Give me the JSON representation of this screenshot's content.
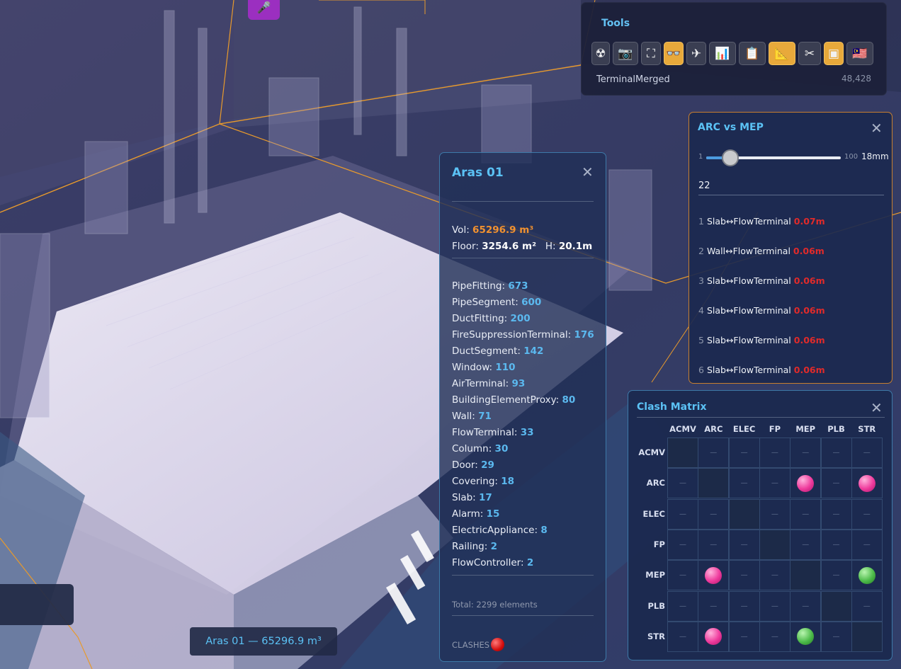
{
  "tools": {
    "title": "Tools",
    "buttons": [
      {
        "name": "radiation-icon",
        "glyph": "☢"
      },
      {
        "name": "camera-icon",
        "glyph": "📷"
      },
      {
        "name": "fullscreen-icon",
        "glyph": "⛶"
      },
      {
        "name": "glasses-icon",
        "glyph": "👓",
        "active": true
      },
      {
        "name": "airplane-icon",
        "glyph": "✈"
      },
      {
        "name": "bar-chart-icon",
        "glyph": "📊"
      },
      {
        "name": "clipboard-icon",
        "glyph": "📋"
      },
      {
        "name": "triangle-ruler-icon",
        "glyph": "📐",
        "active": true
      },
      {
        "name": "scissors-icon",
        "glyph": "✂"
      },
      {
        "name": "floor-plan-icon",
        "glyph": "▣",
        "active": true
      },
      {
        "name": "malaysia-flag-icon",
        "glyph": "🇲🇾"
      }
    ],
    "model_name": "TerminalMerged",
    "model_count": "48,428"
  },
  "clash_detection": {
    "title": "ARC vs MEP",
    "slider_min": "1",
    "slider_max": "100",
    "slider_value_label": "18mm",
    "slider_position": 0.18,
    "clash_count": "22",
    "items": [
      {
        "index": "1",
        "label": "Slab↔FlowTerminal",
        "distance": "0.07m"
      },
      {
        "index": "2",
        "label": "Wall↔FlowTerminal",
        "distance": "0.06m"
      },
      {
        "index": "3",
        "label": "Slab↔FlowTerminal",
        "distance": "0.06m"
      },
      {
        "index": "4",
        "label": "Slab↔FlowTerminal",
        "distance": "0.06m"
      },
      {
        "index": "5",
        "label": "Slab↔FlowTerminal",
        "distance": "0.06m"
      },
      {
        "index": "6",
        "label": "Slab↔FlowTerminal",
        "distance": "0.06m"
      }
    ]
  },
  "aras": {
    "title": "Aras 01",
    "vol_label": "Vol:",
    "vol_value": "65296.9 m³",
    "floor_label": "Floor:",
    "floor_value": "3254.6 m²",
    "height_label": "H:",
    "height_value": "20.1m",
    "elements": [
      {
        "type": "PipeFitting",
        "count": "673"
      },
      {
        "type": "PipeSegment",
        "count": "600"
      },
      {
        "type": "DuctFitting",
        "count": "200"
      },
      {
        "type": "FireSuppressionTerminal",
        "count": "176"
      },
      {
        "type": "DuctSegment",
        "count": "142"
      },
      {
        "type": "Window",
        "count": "110"
      },
      {
        "type": "AirTerminal",
        "count": "93"
      },
      {
        "type": "BuildingElementProxy",
        "count": "80"
      },
      {
        "type": "Wall",
        "count": "71"
      },
      {
        "type": "FlowTerminal",
        "count": "33"
      },
      {
        "type": "Column",
        "count": "30"
      },
      {
        "type": "Door",
        "count": "29"
      },
      {
        "type": "Covering",
        "count": "18"
      },
      {
        "type": "Slab",
        "count": "17"
      },
      {
        "type": "Alarm",
        "count": "15"
      },
      {
        "type": "ElectricAppliance",
        "count": "8"
      },
      {
        "type": "Railing",
        "count": "2"
      },
      {
        "type": "FlowController",
        "count": "2"
      }
    ],
    "total": "Total: 2299 elements",
    "clashes_label": "CLASHES"
  },
  "matrix": {
    "title": "Clash Matrix",
    "columns": [
      "ACMV",
      "ARC",
      "ELEC",
      "FP",
      "MEP",
      "PLB",
      "STR"
    ],
    "rows": [
      "ACMV",
      "ARC",
      "ELEC",
      "FP",
      "MEP",
      "PLB",
      "STR"
    ],
    "empty_symbol": "—",
    "cells": [
      [
        "diag",
        "empty",
        "empty",
        "empty",
        "empty",
        "empty",
        "empty"
      ],
      [
        "empty",
        "diag",
        "empty",
        "empty",
        "pink",
        "empty",
        "pink"
      ],
      [
        "empty",
        "empty",
        "diag",
        "empty",
        "empty",
        "empty",
        "empty"
      ],
      [
        "empty",
        "empty",
        "empty",
        "diag",
        "empty",
        "empty",
        "empty"
      ],
      [
        "empty",
        "pink",
        "empty",
        "empty",
        "diag",
        "empty",
        "green"
      ],
      [
        "empty",
        "empty",
        "empty",
        "empty",
        "empty",
        "diag",
        "empty"
      ],
      [
        "empty",
        "pink",
        "empty",
        "empty",
        "green",
        "empty",
        "diag"
      ]
    ]
  },
  "status_bar": {
    "selection_text": "Aras 01 — 65296.9 m³"
  },
  "mic": {
    "glyph": "🎤"
  },
  "colors": {
    "accent_blue": "#5bc2f5",
    "volume_orange": "#f1912f",
    "clash_red": "#e02a2a",
    "pink_clash": "#ef3a9c",
    "green_clash": "#4dbb4a",
    "tool_active": "#e8a93b"
  }
}
